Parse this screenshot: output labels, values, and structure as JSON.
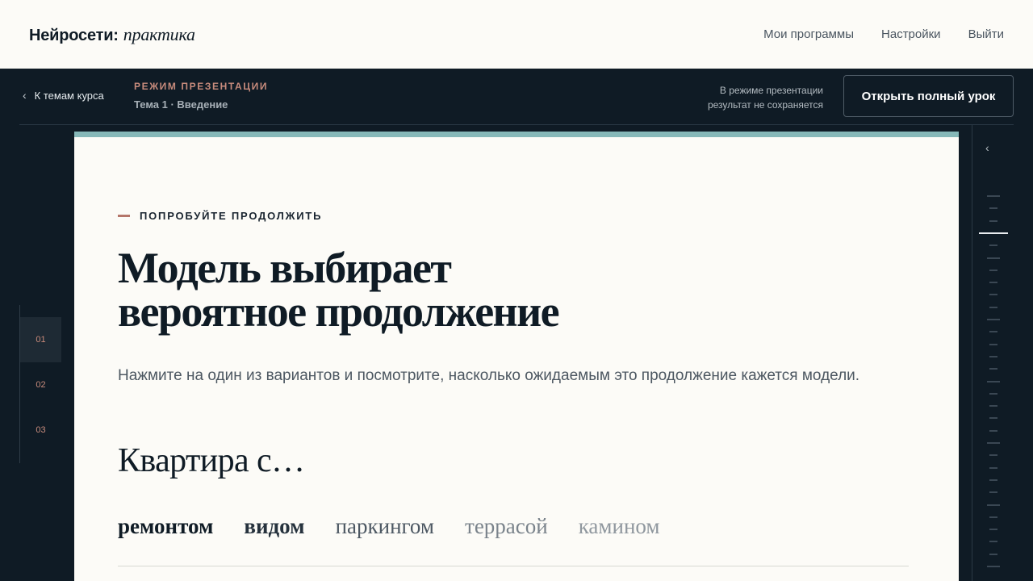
{
  "header": {
    "brand_main": "Нейросети:",
    "brand_italic": "практика",
    "nav": [
      "Мои программы",
      "Настройки",
      "Выйти"
    ]
  },
  "presbar": {
    "back_label": "К темам курса",
    "mode_label": "РЕЖИМ ПРЕЗЕНТАЦИИ",
    "topic": "Тема 1 · Введение",
    "note_line1": "В режиме презентации",
    "note_line2": "результат не сохраняется",
    "open_button": "Открыть полный урок"
  },
  "steps": [
    "01",
    "02",
    "03"
  ],
  "slide": {
    "eyebrow": "ПОПРОБУЙТЕ ПРОДОЛЖИТЬ",
    "headline_line1": "Модель выбирает",
    "headline_line2": "вероятное продолжение",
    "description": "Нажмите на один из вариантов и посмотрите, насколько ожидаемым это продолжение кажется модели.",
    "prompt": "Квартира с…",
    "options": [
      "ремонтом",
      "видом",
      "паркингом",
      "террасой",
      "камином"
    ]
  },
  "colors": {
    "dark_bg": "#0f1b25",
    "paper": "#fcfbf7",
    "accent": "#c78b7c",
    "teal": "#86b8b8"
  }
}
